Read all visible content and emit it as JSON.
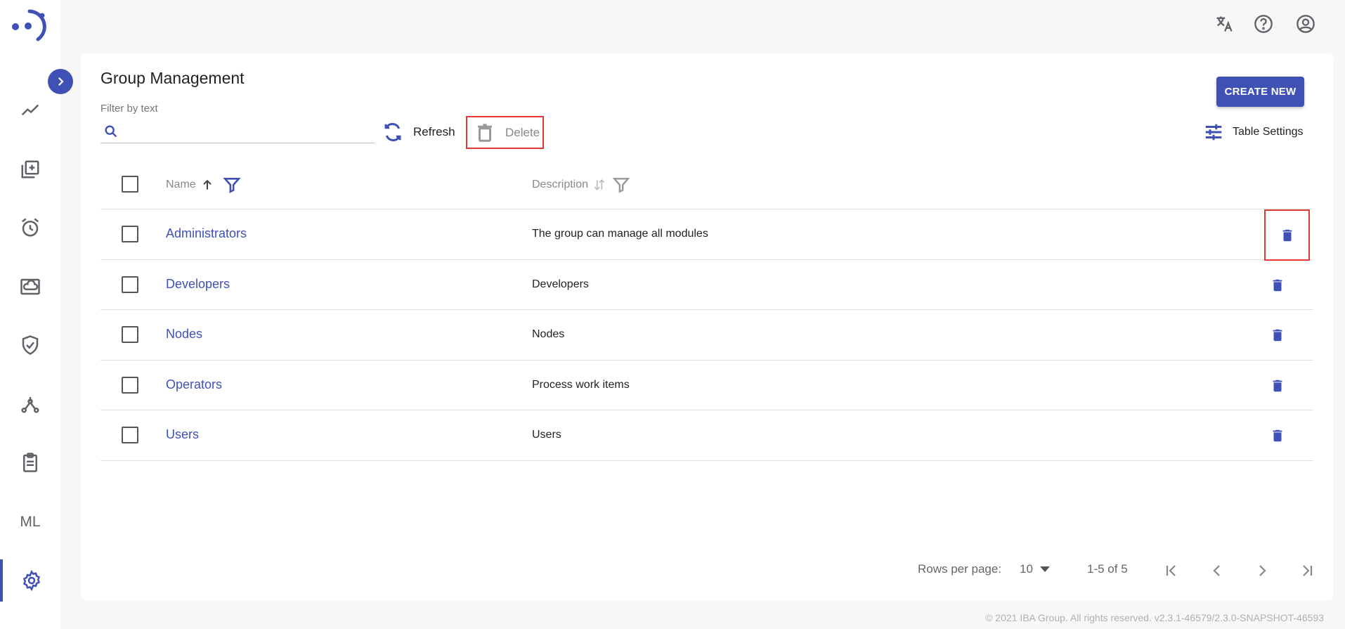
{
  "header": {
    "icons": [
      "translate-icon",
      "help-icon",
      "account-icon"
    ]
  },
  "sidebar": {
    "items": [
      {
        "icon": "trend-icon"
      },
      {
        "icon": "library-add-icon"
      },
      {
        "icon": "alarm-icon"
      },
      {
        "icon": "cloud-storage-icon"
      },
      {
        "icon": "shield-check-icon"
      },
      {
        "icon": "network-icon"
      },
      {
        "icon": "clipboard-icon"
      },
      {
        "label": "ML"
      },
      {
        "icon": "gear-icon",
        "active": true
      }
    ]
  },
  "page": {
    "title": "Group Management",
    "filter_label": "Filter by text",
    "filter_value": ""
  },
  "toolbar": {
    "refresh_label": "Refresh",
    "delete_label": "Delete",
    "create_label": "CREATE NEW",
    "table_settings_label": "Table Settings"
  },
  "table": {
    "columns": [
      "Name",
      "Description"
    ],
    "rows": [
      {
        "name": "Administrators",
        "description": "The group can manage all modules"
      },
      {
        "name": "Developers",
        "description": "Developers"
      },
      {
        "name": "Nodes",
        "description": "Nodes"
      },
      {
        "name": "Operators",
        "description": "Process work items"
      },
      {
        "name": "Users",
        "description": "Users"
      }
    ]
  },
  "pagination": {
    "rows_per_page_label": "Rows per page:",
    "rows_per_page": "10",
    "range": "1-5 of 5"
  },
  "footer": {
    "text": "© 2021 IBA Group. All rights reserved. v2.3.1-46579/2.3.0-SNAPSHOT-46593"
  },
  "colors": {
    "accent": "#3f51b5",
    "highlight_border": "#e53935"
  }
}
